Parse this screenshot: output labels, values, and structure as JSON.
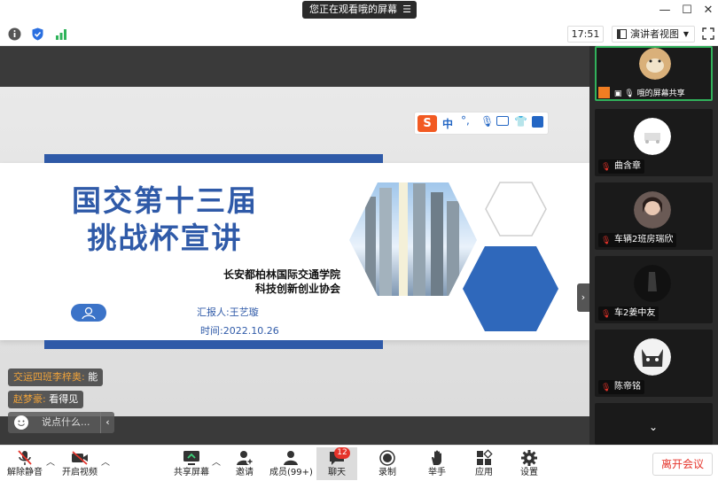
{
  "titlebar": {
    "share_status": "您正在观看哦的屏幕",
    "menu_icon": "menu-icon"
  },
  "infobar": {
    "time": "17:51",
    "view_label": "演讲者视图"
  },
  "slide": {
    "title_line1": "国交第十三届",
    "title_line2": "挑战杯宣讲",
    "org_line1": "长安都柏林国际交通学院",
    "org_line2": "科技创新创业协会",
    "reporter": "汇报人:王艺璇",
    "date": "时间:2022.10.26",
    "ime_label": "中"
  },
  "chat": {
    "messages": [
      {
        "name": "交运四班李梓奥:",
        "text": " 能"
      },
      {
        "name": "赵梦豪:",
        "text": " 看得见"
      }
    ],
    "input_placeholder": "说点什么..."
  },
  "participants": [
    {
      "name": "哦的屏幕共享"
    },
    {
      "name": "曲含章"
    },
    {
      "name": "车辆2班房瑞欣"
    },
    {
      "name": "车2姜中友"
    },
    {
      "name": "陈帝铭"
    }
  ],
  "toolbar": {
    "unmute": "解除静音",
    "start_video": "开启视频",
    "share_screen": "共享屏幕",
    "invite": "邀请",
    "members": "成员(99+)",
    "chat": "聊天",
    "chat_badge": "12",
    "record": "录制",
    "raise_hand": "举手",
    "apps": "应用",
    "settings": "设置",
    "leave": "离开会议"
  },
  "colors": {
    "brand_blue": "#2f5aa8",
    "leave_red": "#e5332a",
    "active_green": "#31b15b",
    "chat_name": "#f0a33a"
  }
}
